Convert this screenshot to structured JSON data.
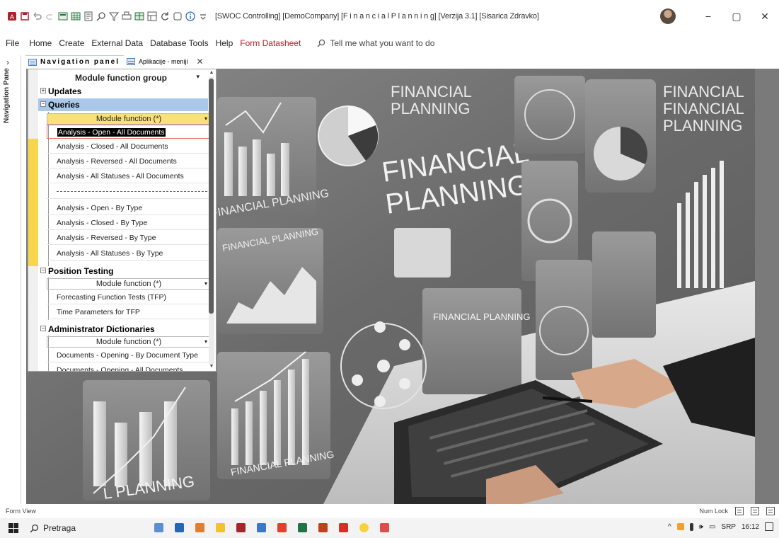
{
  "window": {
    "title": "[SWOC Controlling] [DemoCompany] [F i n a n c i a l  P l a n n i n g] [Verzija 3.1] [Sisarica Zdravko]",
    "minimize": "−",
    "restore": "▢",
    "close": "✕"
  },
  "ribbon": {
    "tabs": [
      "File",
      "Home",
      "Create",
      "External Data",
      "Database Tools",
      "Help",
      "Form Datasheet"
    ],
    "tell_me": "Tell me what you want to do"
  },
  "nav_pane": {
    "label": "Navigation Pane",
    "chevron": "›"
  },
  "doc_tabs": [
    {
      "label": "Navigation panel"
    },
    {
      "label": "Aplikacije - meniji"
    }
  ],
  "nav_tree": {
    "header": "Module function group",
    "groups": [
      {
        "label": "Updates",
        "toggle": "+"
      },
      {
        "label": "Queries",
        "toggle": "−"
      },
      {
        "label": "Position Testing",
        "toggle": "−"
      },
      {
        "label": "Administrator Dictionaries",
        "toggle": "−"
      }
    ],
    "subheader": "Module function (*)",
    "queries_items": [
      "Analysis - Open - All Documents",
      "Analysis - Closed - All Documents",
      "Analysis - Reversed - All Documents",
      "Analysis - All Statuses - All Documents",
      "Analysis - Open - By Type",
      "Analysis - Closed - By Type",
      "Analysis - Reversed - By Type",
      "Analysis - All Statuses - By Type"
    ],
    "position_items": [
      "Forecasting Function Tests (TFP)",
      "Time Parameters for TFP"
    ],
    "admin_items": [
      "Documents - Opening - By Document Type",
      "Documents - Opening - All Documents"
    ]
  },
  "illustration": {
    "texts": [
      "FINANCIAL PLANNING",
      "FINANCIAL",
      "PLANNING",
      "FINANCIAL PLANNING",
      "FINANCIAL PLANNING",
      "FINANCIAL PLANNING",
      "FINANCIAL",
      "FINANCIAL",
      "PLANNING",
      "FINANCIAL",
      "PLANNING",
      "FINANCIAL PLANNING"
    ]
  },
  "statusbar": {
    "left": "Form View",
    "num_lock": "Num Lock"
  },
  "taskbar": {
    "search": "Pretraga",
    "lang": "SRP",
    "time": "16:12"
  },
  "colors": {
    "selected_group": "#a9c8ea",
    "accent_yellow": "#f7d64b",
    "contextual_tab": "#b01f2c"
  }
}
